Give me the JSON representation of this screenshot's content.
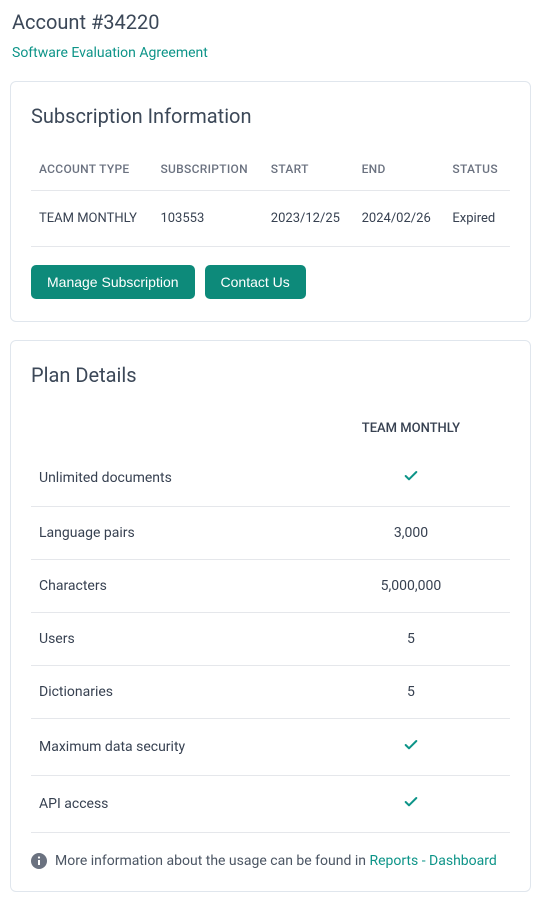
{
  "header": {
    "title": "Account #34220",
    "agreement_link": "Software Evaluation Agreement"
  },
  "subscription": {
    "card_title": "Subscription Information",
    "columns": {
      "account_type": "ACCOUNT TYPE",
      "subscription": "SUBSCRIPTION",
      "start": "START",
      "end": "END",
      "status": "STATUS"
    },
    "row": {
      "account_type": "TEAM MONTHLY",
      "subscription": "103553",
      "start": "2023/12/25",
      "end": "2024/02/26",
      "status": "Expired"
    },
    "buttons": {
      "manage": "Manage Subscription",
      "contact": "Contact Us"
    }
  },
  "plan": {
    "card_title": "Plan Details",
    "column_header": "TEAM MONTHLY",
    "features": {
      "unlimited_docs": {
        "label": "Unlimited documents",
        "value": "check"
      },
      "language_pairs": {
        "label": "Language pairs",
        "value": "3,000"
      },
      "characters": {
        "label": "Characters",
        "value": "5,000,000"
      },
      "users": {
        "label": "Users",
        "value": "5"
      },
      "dictionaries": {
        "label": "Dictionaries",
        "value": "5"
      },
      "max_security": {
        "label": "Maximum data security",
        "value": "check"
      },
      "api_access": {
        "label": "API access",
        "value": "check"
      }
    },
    "info_prefix": "More information about the usage can be found in ",
    "info_link": "Reports - Dashboard"
  }
}
